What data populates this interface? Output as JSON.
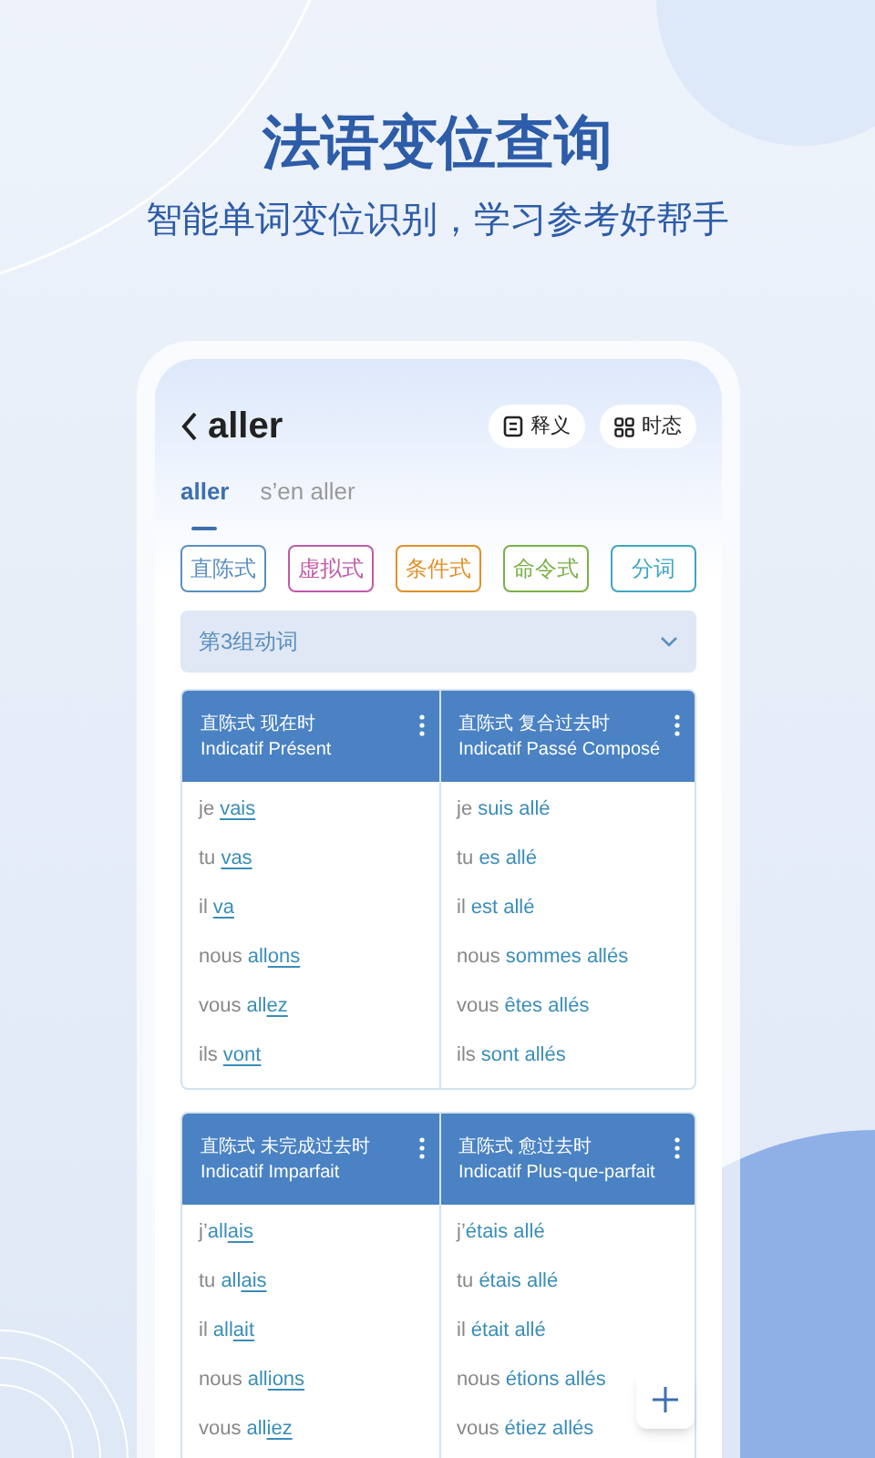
{
  "headline": "法语变位查询",
  "subheadline": "智能单词变位识别，学习参考好帮手",
  "app": {
    "title": "aller",
    "actions": [
      {
        "kind": "definition",
        "label": "释义"
      },
      {
        "kind": "tenses",
        "label": "时态"
      }
    ],
    "tabs": [
      {
        "label": "aller",
        "selected": true
      },
      {
        "label": "s’en aller",
        "selected": false
      }
    ],
    "moods": [
      {
        "label": "直陈式",
        "color": "#5b8fc0"
      },
      {
        "label": "虚拟式",
        "color": "#c05aa8"
      },
      {
        "label": "条件式",
        "color": "#e0902a"
      },
      {
        "label": "命令式",
        "color": "#7ab04a"
      },
      {
        "label": "分词",
        "color": "#3fa6c0"
      }
    ],
    "group": {
      "value": "第3组动词"
    },
    "tables": [
      {
        "columns": [
          {
            "title": "直陈式 现在时",
            "subtitle": "Indicatif Présent",
            "forms": [
              {
                "pronoun": "je",
                "ending": "vais"
              },
              {
                "pronoun": "tu",
                "ending": "vas"
              },
              {
                "pronoun": "il",
                "ending": "va"
              },
              {
                "pronoun": "nous",
                "stem": "all",
                "ending": "ons"
              },
              {
                "pronoun": "vous",
                "stem": "all",
                "ending": "ez"
              },
              {
                "pronoun": "ils",
                "ending": "vont"
              }
            ]
          },
          {
            "title": "直陈式 复合过去时",
            "subtitle": "Indicatif Passé Composé",
            "forms": [
              {
                "pronoun": "je",
                "stem": "suis allé"
              },
              {
                "pronoun": "tu",
                "stem": "es allé"
              },
              {
                "pronoun": "il",
                "stem": "est allé"
              },
              {
                "pronoun": "nous",
                "stem": "sommes allés"
              },
              {
                "pronoun": "vous",
                "stem": "êtes allés"
              },
              {
                "pronoun": "ils",
                "stem": "sont allés"
              }
            ]
          }
        ]
      },
      {
        "columns": [
          {
            "title": "直陈式 未完成过去时",
            "subtitle": "Indicatif Imparfait",
            "forms": [
              {
                "pronoun": "j’",
                "stem": "all",
                "ending": "ais"
              },
              {
                "pronoun": "tu",
                "stem": "all",
                "ending": "ais"
              },
              {
                "pronoun": "il",
                "stem": "all",
                "ending": "ait"
              },
              {
                "pronoun": "nous",
                "stem": "all",
                "ending": "ions"
              },
              {
                "pronoun": "vous",
                "stem": "all",
                "ending": "iez"
              }
            ]
          },
          {
            "title": "直陈式 愈过去时",
            "subtitle": "Indicatif Plus-que-parfait",
            "forms": [
              {
                "pronoun": "j’",
                "stem": "étais allé"
              },
              {
                "pronoun": "tu",
                "stem": "étais allé"
              },
              {
                "pronoun": "il",
                "stem": "était allé"
              },
              {
                "pronoun": "nous",
                "stem": "étions allés"
              },
              {
                "pronoun": "vous",
                "stem": "étiez allés"
              }
            ]
          }
        ]
      }
    ]
  }
}
